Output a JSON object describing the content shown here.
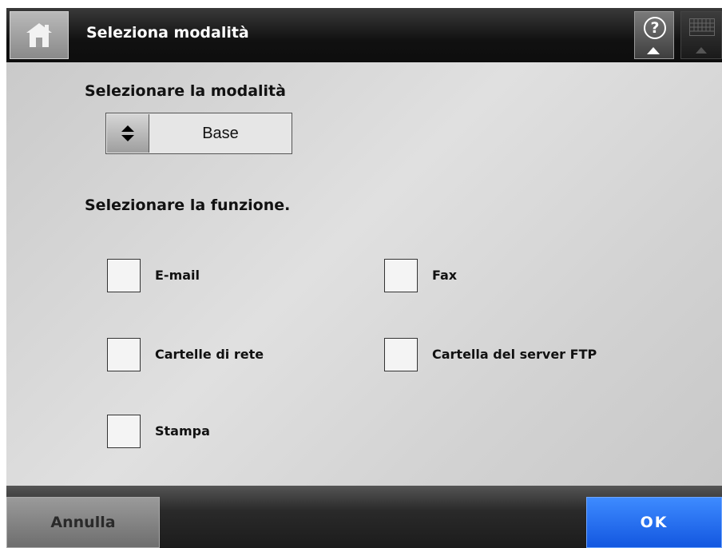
{
  "header": {
    "title": "Seleziona modalità",
    "help_glyph": "?",
    "icons": [
      "home-icon",
      "help-icon",
      "keyboard-icon"
    ]
  },
  "mode": {
    "label": "Selezionare la modalità",
    "value": "Base"
  },
  "function": {
    "label": "Selezionare la funzione.",
    "options": [
      {
        "label": "E-mail",
        "checked": false
      },
      {
        "label": "Fax",
        "checked": false
      },
      {
        "label": "Cartelle di rete",
        "checked": false
      },
      {
        "label": "Cartella del server FTP",
        "checked": false
      },
      {
        "label": "Stampa",
        "checked": false
      }
    ]
  },
  "footer": {
    "cancel_label": "Annulla",
    "ok_label": "OK"
  },
  "colors": {
    "ok_button": "#1f6bf0",
    "header": "#111111"
  }
}
